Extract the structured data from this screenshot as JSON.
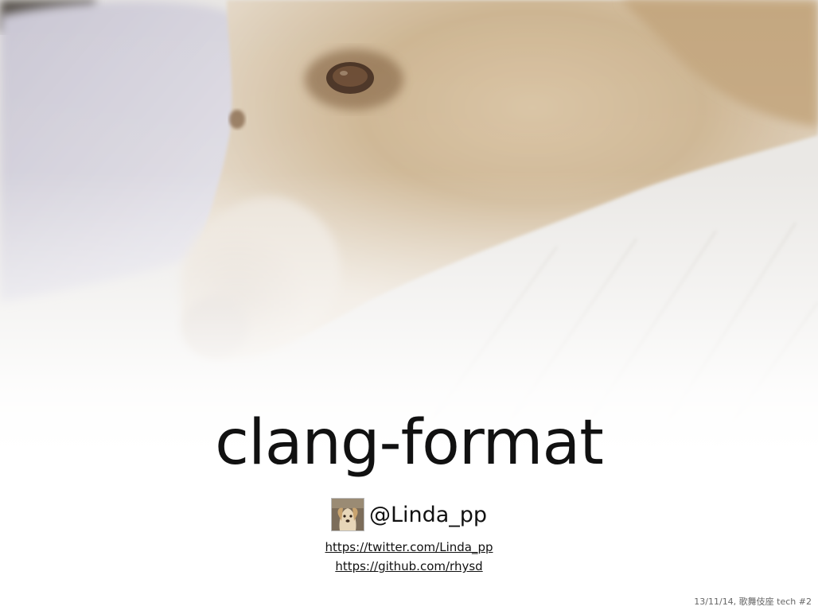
{
  "slide": {
    "title": "clang-format",
    "author": {
      "handle": "@Linda_pp",
      "avatar_icon": "dog-avatar-icon"
    },
    "links": [
      "https://twitter.com/Linda_pp",
      "https://github.com/rhysd"
    ],
    "footer": "13/11/14, 歌舞伎座 tech #2"
  }
}
